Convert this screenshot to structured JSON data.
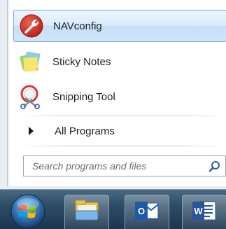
{
  "start_menu": {
    "programs": [
      {
        "label": "NAVconfig",
        "icon": "navconfig-icon",
        "selected": true
      },
      {
        "label": "Sticky Notes",
        "icon": "sticky-notes-icon",
        "selected": false
      },
      {
        "label": "Snipping Tool",
        "icon": "snipping-tool-icon",
        "selected": false
      }
    ],
    "all_programs_label": "All Programs",
    "search": {
      "placeholder": "Search programs and files",
      "value": "",
      "icon": "search-icon"
    }
  },
  "taskbar": {
    "start_button_icon": "windows-orb-icon",
    "pinned": [
      {
        "name": "file-explorer",
        "icon": "folder-icon"
      },
      {
        "name": "outlook",
        "icon": "outlook-icon"
      },
      {
        "name": "word",
        "icon": "word-icon"
      }
    ]
  },
  "colors": {
    "selection": "#cfe5fa",
    "taskbar": "#2e4c66",
    "navconfig_red": "#d83a2e"
  }
}
